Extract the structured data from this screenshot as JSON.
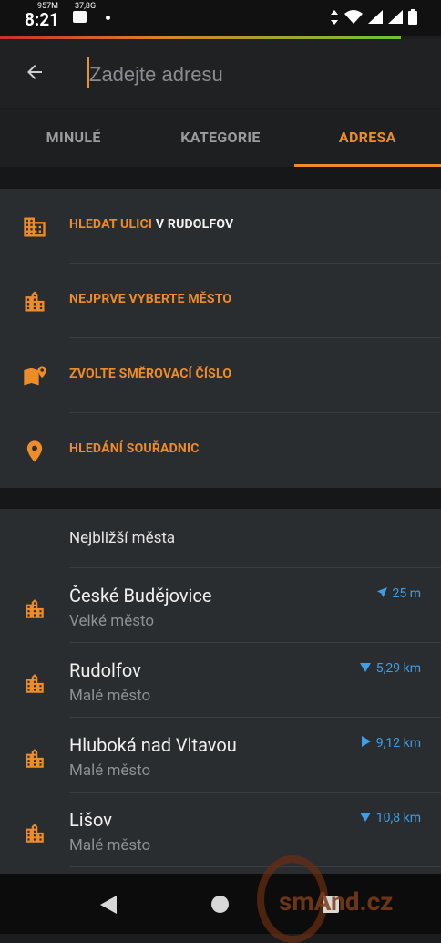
{
  "status_bar": {
    "time": "8:21",
    "memory": "957M",
    "net": "37,8G"
  },
  "header": {
    "search_placeholder": "Zadejte adresu"
  },
  "tabs": [
    {
      "label": "MINULÉ"
    },
    {
      "label": "KATEGORIE"
    },
    {
      "label": "ADRESA"
    }
  ],
  "actions": {
    "street_prefix": "HLEDAT ULICI",
    "street_suffix": "V RUDOLFOV",
    "choose_city": "NEJPRVE VYBERTE MĚSTO",
    "postcode": "ZVOLTE SMĚROVACÍ ČÍSLO",
    "coordinates": "HLEDÁNÍ SOUŘADNIC"
  },
  "cities": {
    "title": "Nejbližší města",
    "items": [
      {
        "name": "České Budějovice",
        "type": "Velké město",
        "distance": "25 m"
      },
      {
        "name": "Rudolfov",
        "type": "Malé město",
        "distance": "5,29 km"
      },
      {
        "name": "Hluboká nad Vltavou",
        "type": "Malé město",
        "distance": "9,12 km"
      },
      {
        "name": "Lišov",
        "type": "Malé město",
        "distance": "10,8 km"
      }
    ]
  },
  "watermark": "smAnd.cz",
  "colors": {
    "accent": "#ee8c2a",
    "distance": "#3f9ee8",
    "panel": "#2a2d2f",
    "background": "#1b1d1f"
  }
}
